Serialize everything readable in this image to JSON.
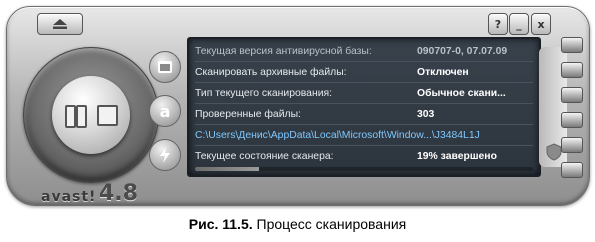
{
  "window": {
    "help_label": "?",
    "min_label": "_",
    "close_label": "x"
  },
  "app": {
    "logo": "avast!",
    "version": "4.8"
  },
  "side_icons": [
    {
      "name": "browser-icon"
    },
    {
      "name": "avast-a-icon",
      "label": "a"
    },
    {
      "name": "lightning-icon"
    }
  ],
  "status": {
    "rows": [
      {
        "label": "Текущая версия антивирусной базы:",
        "value": "090707-0, 07.07.09",
        "dim": true
      },
      {
        "label": "Сканировать архивные файлы:",
        "value": "Отключен"
      },
      {
        "label": "Тип текущего сканирования:",
        "value": "Обычное скани..."
      },
      {
        "label": "Проверенные файлы:",
        "value": "303"
      },
      {
        "label": "C:\\Users\\Денис\\AppData\\Local\\Microsoft\\Window...\\J3484L1J",
        "value": "",
        "path": true
      },
      {
        "label": "Текущее состояние сканера:",
        "value": "19% завершено"
      }
    ],
    "progress_percent": 19
  },
  "caption": {
    "prefix": "Рис. 11.5.",
    "text": " Процесс сканирования"
  }
}
